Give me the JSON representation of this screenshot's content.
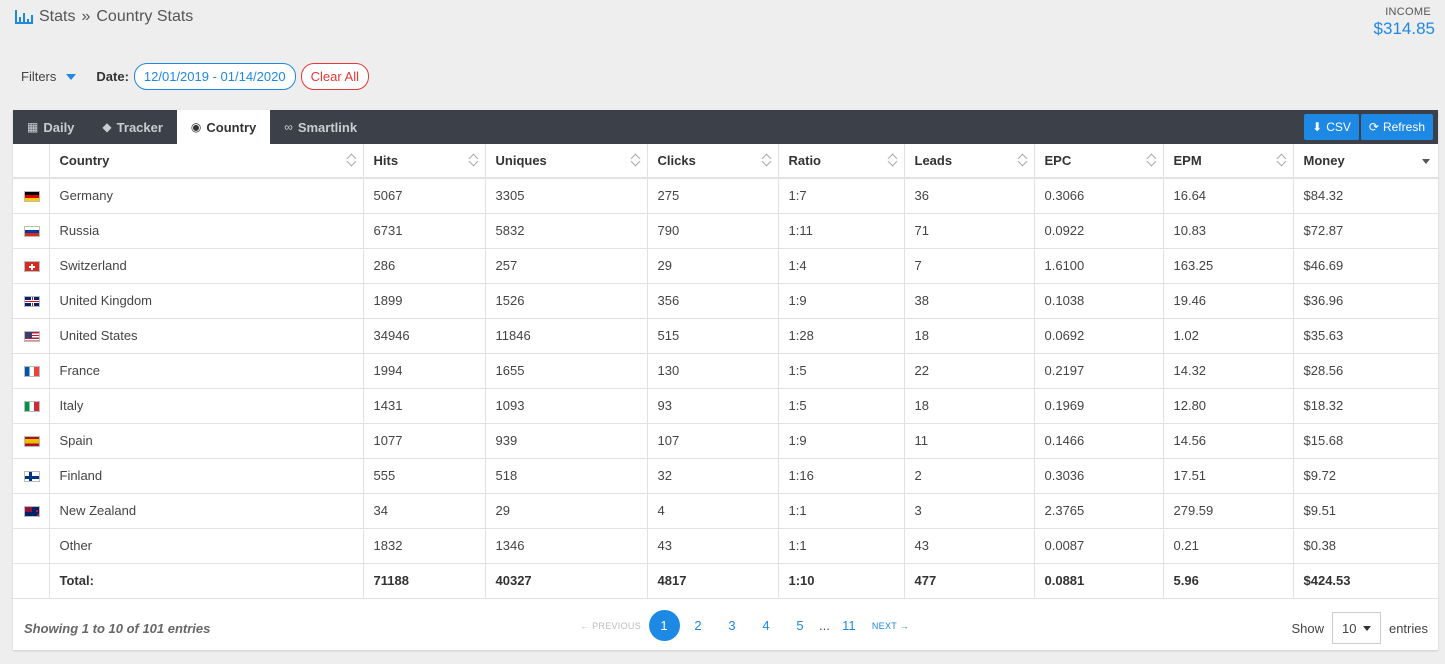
{
  "breadcrumb": {
    "root": "Stats",
    "separator": "»",
    "current": "Country Stats"
  },
  "income": {
    "label": "INCOME",
    "value": "$314.85"
  },
  "filters": {
    "label": "Filters",
    "date_label": "Date:",
    "date_range": "12/01/2019 - 01/14/2020",
    "clear_all": "Clear All"
  },
  "tabs": [
    {
      "label": "Daily",
      "icon": "calendar-icon"
    },
    {
      "label": "Tracker",
      "icon": "tag-icon"
    },
    {
      "label": "Country",
      "icon": "globe-icon",
      "active": true
    },
    {
      "label": "Smartlink",
      "icon": "link-icon"
    }
  ],
  "actions": {
    "csv": "CSV",
    "refresh": "Refresh"
  },
  "table": {
    "columns": [
      "Country",
      "Hits",
      "Uniques",
      "Clicks",
      "Ratio",
      "Leads",
      "EPC",
      "EPM",
      "Money"
    ],
    "rows": [
      {
        "flag": "de",
        "cells": [
          "Germany",
          "5067",
          "3305",
          "275",
          "1:7",
          "36",
          "0.3066",
          "16.64",
          "$84.32"
        ]
      },
      {
        "flag": "ru",
        "cells": [
          "Russia",
          "6731",
          "5832",
          "790",
          "1:11",
          "71",
          "0.0922",
          "10.83",
          "$72.87"
        ]
      },
      {
        "flag": "ch",
        "cells": [
          "Switzerland",
          "286",
          "257",
          "29",
          "1:4",
          "7",
          "1.6100",
          "163.25",
          "$46.69"
        ]
      },
      {
        "flag": "gb",
        "cells": [
          "United Kingdom",
          "1899",
          "1526",
          "356",
          "1:9",
          "38",
          "0.1038",
          "19.46",
          "$36.96"
        ]
      },
      {
        "flag": "us",
        "cells": [
          "United States",
          "34946",
          "11846",
          "515",
          "1:28",
          "18",
          "0.0692",
          "1.02",
          "$35.63"
        ]
      },
      {
        "flag": "fr",
        "cells": [
          "France",
          "1994",
          "1655",
          "130",
          "1:5",
          "22",
          "0.2197",
          "14.32",
          "$28.56"
        ]
      },
      {
        "flag": "it",
        "cells": [
          "Italy",
          "1431",
          "1093",
          "93",
          "1:5",
          "18",
          "0.1969",
          "12.80",
          "$18.32"
        ]
      },
      {
        "flag": "es",
        "cells": [
          "Spain",
          "1077",
          "939",
          "107",
          "1:9",
          "11",
          "0.1466",
          "14.56",
          "$15.68"
        ]
      },
      {
        "flag": "fi",
        "cells": [
          "Finland",
          "555",
          "518",
          "32",
          "1:16",
          "2",
          "0.3036",
          "17.51",
          "$9.72"
        ]
      },
      {
        "flag": "nz",
        "cells": [
          "New Zealand",
          "34",
          "29",
          "4",
          "1:1",
          "3",
          "2.3765",
          "279.59",
          "$9.51"
        ]
      },
      {
        "flag": "",
        "cells": [
          "Other",
          "1832",
          "1346",
          "43",
          "1:1",
          "43",
          "0.0087",
          "0.21",
          "$0.38"
        ]
      }
    ],
    "total": [
      "Total:",
      "71188",
      "40327",
      "4817",
      "1:10",
      "477",
      "0.0881",
      "5.96",
      "$424.53"
    ]
  },
  "footer": {
    "showing": "Showing 1 to 10 of 101 entries",
    "previous": "← PREVIOUS",
    "next": "NEXT →",
    "pages": [
      "1",
      "2",
      "3",
      "4",
      "5"
    ],
    "dots": "...",
    "last_page": "11",
    "show_label": "Show",
    "page_length": "10",
    "entries_label": "entries"
  },
  "colors": {
    "accent": "#1e88e5",
    "danger": "#e53935",
    "tabbar": "#3c4149"
  }
}
